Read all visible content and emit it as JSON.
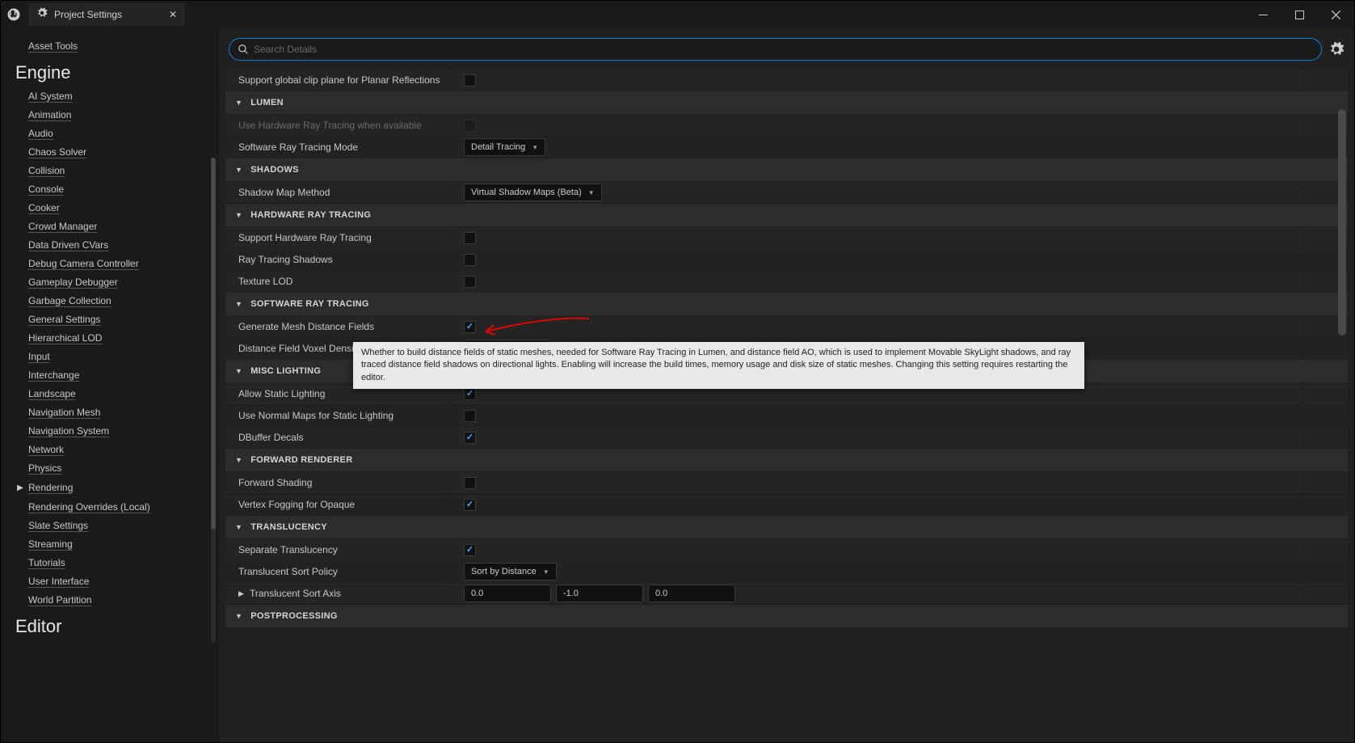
{
  "tab": {
    "title": "Project Settings"
  },
  "search": {
    "placeholder": "Search Details"
  },
  "sidebar": {
    "top_links": [
      "Asset Tools"
    ],
    "section1_header": "Engine",
    "section1_items": [
      "AI System",
      "Animation",
      "Audio",
      "Chaos Solver",
      "Collision",
      "Console",
      "Cooker",
      "Crowd Manager",
      "Data Driven CVars",
      "Debug Camera Controller",
      "Gameplay Debugger",
      "Garbage Collection",
      "General Settings",
      "Hierarchical LOD",
      "Input",
      "Interchange",
      "Landscape",
      "Navigation Mesh",
      "Navigation System",
      "Network",
      "Physics",
      "Rendering",
      "Rendering Overrides (Local)",
      "Slate Settings",
      "Streaming",
      "Tutorials",
      "User Interface",
      "World Partition"
    ],
    "section1_active_index": 21,
    "section2_header": "Editor"
  },
  "settings": {
    "top_row": {
      "label": "Support global clip plane for Planar Reflections",
      "checked": false
    },
    "sections": [
      {
        "title": "LUMEN",
        "rows": [
          {
            "label": "Use Hardware Ray Tracing when available",
            "type": "checkbox",
            "checked": false,
            "disabled": true
          },
          {
            "label": "Software Ray Tracing Mode",
            "type": "dropdown",
            "value": "Detail Tracing"
          }
        ]
      },
      {
        "title": "SHADOWS",
        "rows": [
          {
            "label": "Shadow Map Method",
            "type": "dropdown",
            "value": "Virtual Shadow Maps (Beta)"
          }
        ]
      },
      {
        "title": "HARDWARE RAY TRACING",
        "rows": [
          {
            "label": "Support Hardware Ray Tracing",
            "type": "checkbox",
            "checked": false
          },
          {
            "label": "Ray Tracing Shadows",
            "type": "checkbox",
            "checked": false
          },
          {
            "label": "Texture LOD",
            "type": "checkbox",
            "checked": false
          }
        ]
      },
      {
        "title": "SOFTWARE RAY TRACING",
        "rows": [
          {
            "label": "Generate Mesh Distance Fields",
            "type": "checkbox",
            "checked": true
          },
          {
            "label": "Distance Field Voxel Density",
            "type": "number",
            "value": ""
          }
        ]
      },
      {
        "title": "MISC LIGHTING",
        "rows": [
          {
            "label": "Allow Static Lighting",
            "type": "checkbox",
            "checked": true
          },
          {
            "label": "Use Normal Maps for Static Lighting",
            "type": "checkbox",
            "checked": false
          },
          {
            "label": "DBuffer Decals",
            "type": "checkbox",
            "checked": true
          }
        ]
      },
      {
        "title": "FORWARD RENDERER",
        "rows": [
          {
            "label": "Forward Shading",
            "type": "checkbox",
            "checked": false
          },
          {
            "label": "Vertex Fogging for Opaque",
            "type": "checkbox",
            "checked": true
          }
        ]
      },
      {
        "title": "TRANSLUCENCY",
        "rows": [
          {
            "label": "Separate Translucency",
            "type": "checkbox",
            "checked": true
          },
          {
            "label": "Translucent Sort Policy",
            "type": "dropdown",
            "value": "Sort by Distance"
          },
          {
            "label": "Translucent Sort Axis",
            "type": "vec3",
            "x": "0.0",
            "y": "-1.0",
            "z": "0.0",
            "expandable": true
          }
        ]
      },
      {
        "title": "POSTPROCESSING",
        "rows": []
      }
    ]
  },
  "tooltip": {
    "text": "Whether to build distance fields of static meshes, needed for Software Ray Tracing in Lumen, and distance field AO, which is used to implement Movable SkyLight shadows, and ray traced distance field shadows on directional lights.  Enabling will increase the build times, memory usage and disk size of static meshes.  Changing this setting requires restarting the editor."
  }
}
